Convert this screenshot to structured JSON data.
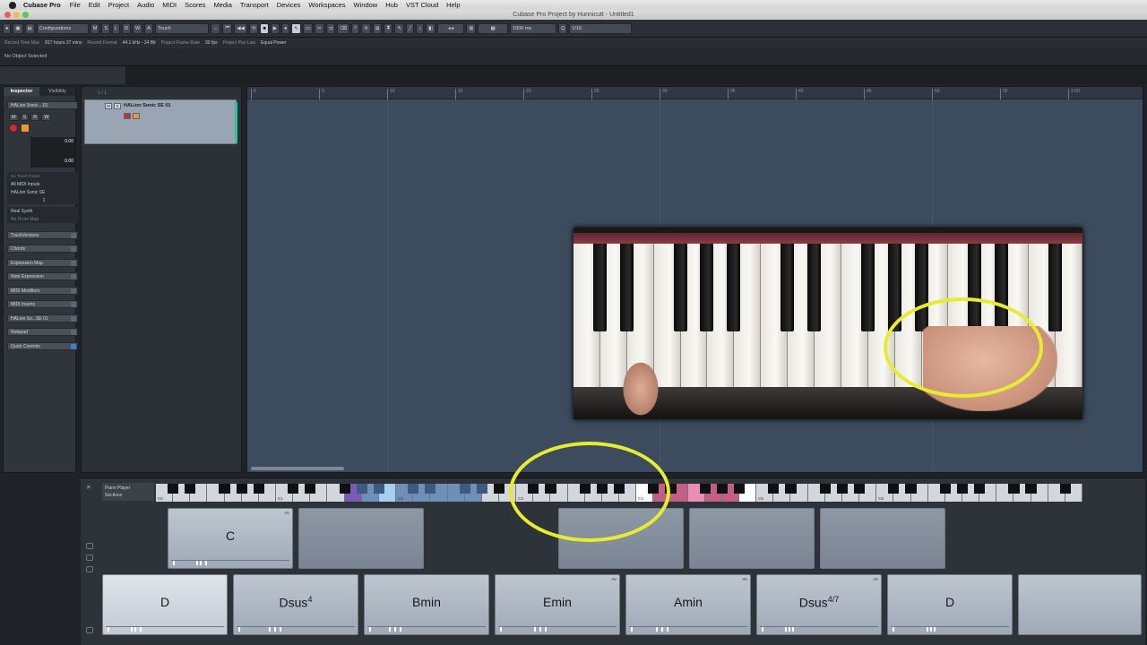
{
  "menubar": {
    "app": "Cubase Pro",
    "items": [
      "File",
      "Edit",
      "Project",
      "Audio",
      "MIDI",
      "Scores",
      "Media",
      "Transport",
      "Devices",
      "Workspaces",
      "Window",
      "Hub",
      "VST Cloud",
      "Help"
    ]
  },
  "window": {
    "title": "Cubase Pro Project by Hunnicutt - Untitled1"
  },
  "toolbar": {
    "configurations": "Configurations",
    "letters": [
      "M",
      "S",
      "L",
      "R",
      "W",
      "A"
    ],
    "automation_mode": "Touch",
    "nudge_value": "1000 ms",
    "quantize_value": "1/16"
  },
  "infoline": {
    "record_time_label": "Record Time Max",
    "record_time_value": "817 hours 37 mins",
    "record_format_label": "Record Format",
    "record_format_value": "44.1 kHz - 24 Bit",
    "frame_rate_label": "Project Frame Rate",
    "frame_rate_value": "30 fps",
    "pan_law_label": "Project Pan Law",
    "pan_law_value": "Equal Power"
  },
  "objline": {
    "text": "No Object Selected"
  },
  "inspector": {
    "tab_inspector": "Inspector",
    "tab_visibility": "Visibility",
    "track_name": "HALion Sonic ...01",
    "value1": "0.00",
    "value2": "0.00",
    "no_track_preset": "No Track Preset",
    "midi_inputs": "All MIDI Inputs",
    "output": "HALion Sonic SE",
    "channel": "1",
    "real_synth": "Real Synth",
    "no_drum_map": "No Drum Map",
    "sections": [
      "TrackVersions",
      "Chords",
      "Expression Map",
      "Note Expression",
      "MIDI Modifiers",
      "MIDI Inserts",
      "HALion So...SE 01",
      "Notepad",
      "Quick Controls"
    ]
  },
  "tracklist": {
    "counter": "1 / 1",
    "track_name": "HALion Sonic SE 01",
    "btn_m": "M",
    "btn_s": "S"
  },
  "ruler": {
    "ticks": [
      "0",
      "5",
      "10",
      "15",
      "20",
      "25",
      "30",
      "35",
      "40",
      "45",
      "50",
      "55",
      "1:00"
    ]
  },
  "chordpads": {
    "player_label": "Piano Player",
    "sections_label": "Sections",
    "key_labels": [
      "C0",
      "C1",
      "C2",
      "C3",
      "C4",
      "C5",
      "C6"
    ],
    "top_row": [
      {
        "label": "C",
        "av": "AV"
      },
      {
        "label": ""
      },
      {
        "label": ""
      },
      {
        "label": ""
      },
      {
        "label": ""
      },
      {
        "label": ""
      }
    ],
    "bottom_row": [
      {
        "label": "D",
        "av": ""
      },
      {
        "label": "Dsus4",
        "av": ""
      },
      {
        "label": "Bmin",
        "av": ""
      },
      {
        "label": "Emin",
        "av": "AV"
      },
      {
        "label": "Amin",
        "av": "AV"
      },
      {
        "label": "Dsus4/7",
        "av": "AV"
      },
      {
        "label": "D",
        "av": ""
      },
      {
        "label": "",
        "av": ""
      }
    ]
  },
  "colors": {
    "highlight_ring": "#e7ec2e",
    "project_bg": "#3c4b5d"
  }
}
